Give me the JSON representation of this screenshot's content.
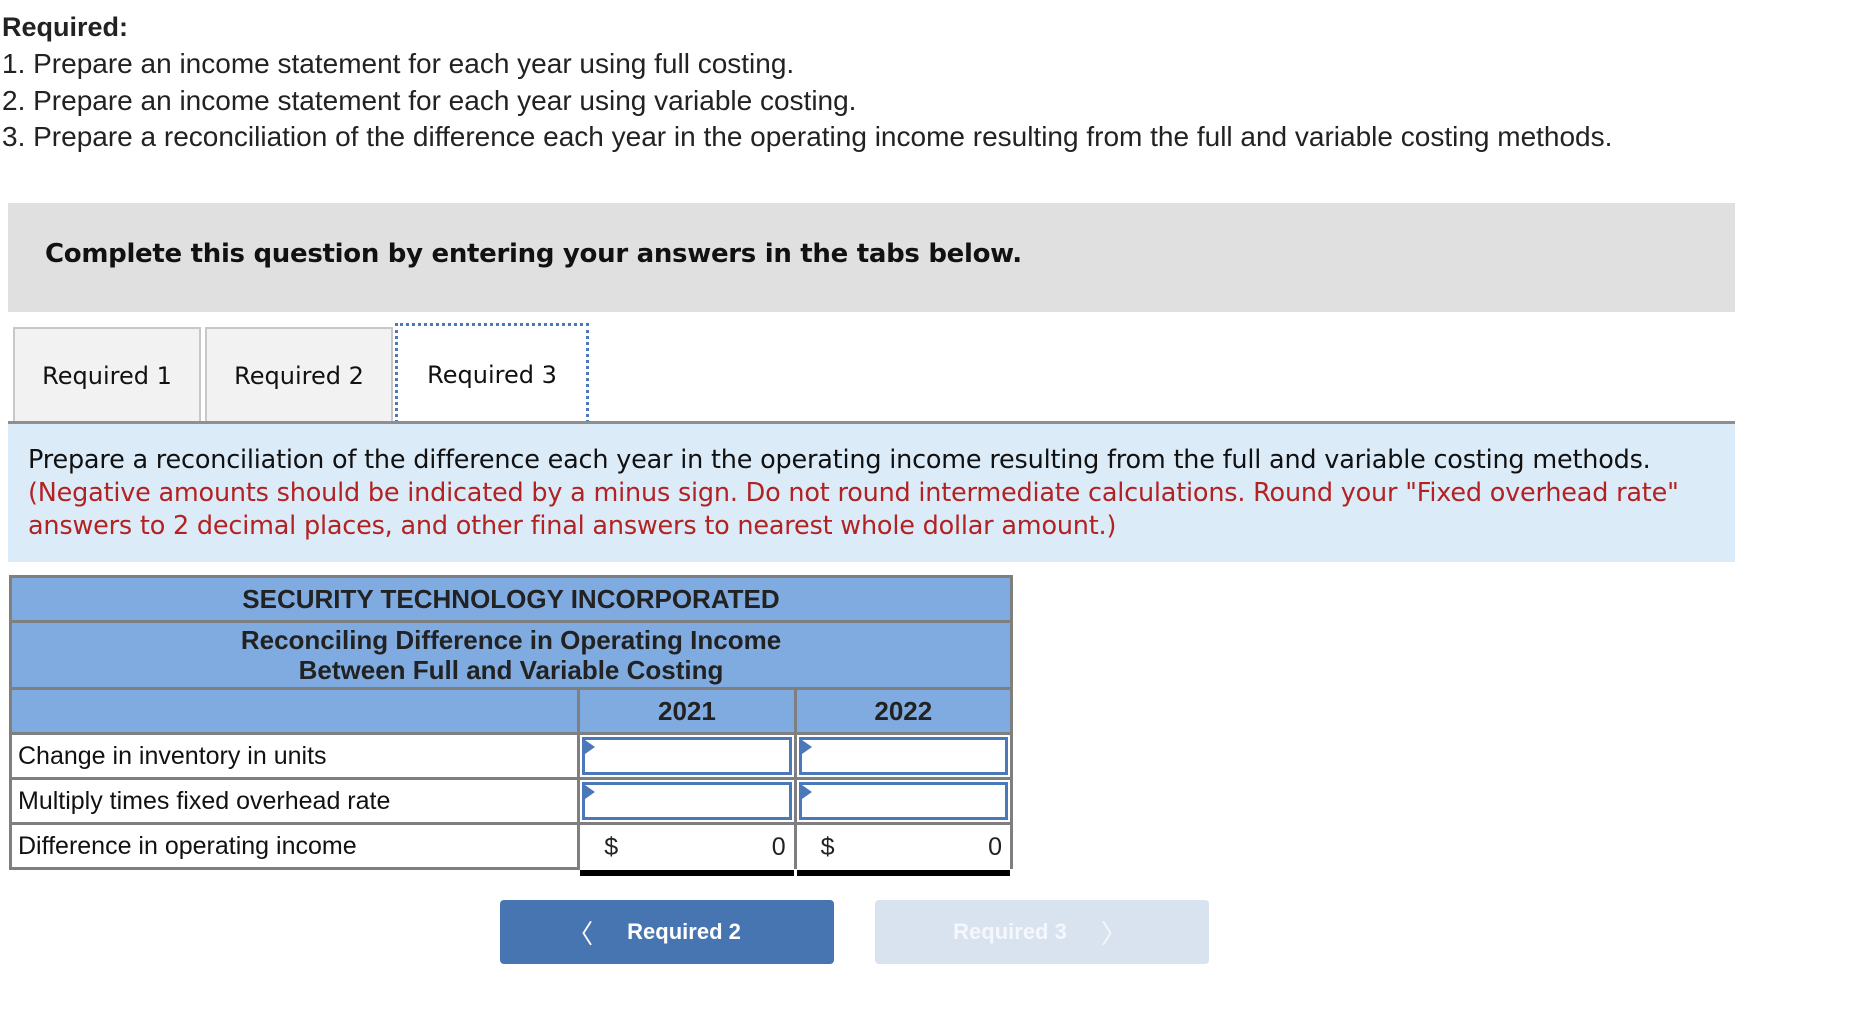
{
  "required": {
    "heading": "Required:",
    "items": [
      "1. Prepare an income statement for each year using full costing.",
      "2. Prepare an income statement for each year using variable costing.",
      "3. Prepare a reconciliation of the difference each year in the operating income resulting from the full and variable costing methods."
    ]
  },
  "instruction_banner": "Complete this question by entering your answers in the tabs below.",
  "tabs": [
    {
      "label": "Required 1",
      "active": false
    },
    {
      "label": "Required 2",
      "active": false
    },
    {
      "label": "Required 3",
      "active": true
    }
  ],
  "question": {
    "text": "Prepare a reconciliation of the difference each year in the operating income resulting from the full and variable costing methods.",
    "note": "(Negative amounts should be indicated by a minus sign. Do not round intermediate calculations. Round your \"Fixed overhead rate\" answers to 2 decimal places, and other final answers to nearest whole dollar amount.)",
    "note_color": "#b22222"
  },
  "table": {
    "company": "SECURITY TECHNOLOGY INCORPORATED",
    "title_line1": "Reconciling Difference in Operating Income",
    "title_line2": "Between Full and Variable Costing",
    "columns": [
      "2021",
      "2022"
    ],
    "rows": [
      {
        "label": "Change in inventory in units",
        "values": [
          "",
          ""
        ],
        "editable": true
      },
      {
        "label": "Multiply times fixed overhead rate",
        "values": [
          "",
          ""
        ],
        "editable": true
      },
      {
        "label": "Difference in operating income",
        "currency": "$",
        "values": [
          "0",
          "0"
        ],
        "editable": false
      }
    ],
    "header_color": "#7fabe0"
  },
  "nav": {
    "prev_label": "Required 2",
    "next_label": "Required 3",
    "prev_icon": "chevron-left-icon",
    "next_icon": "chevron-right-icon",
    "prev_color": "#4775b2",
    "next_color": "#d9e3ef"
  }
}
